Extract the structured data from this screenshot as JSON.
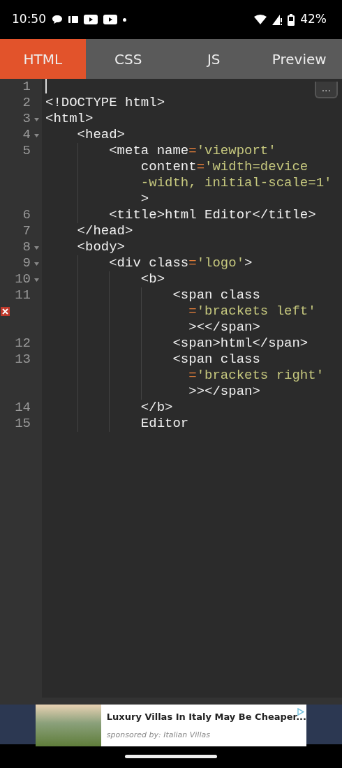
{
  "status_bar": {
    "time": "10:50",
    "battery": "42%"
  },
  "tabs": [
    {
      "label": "HTML",
      "selected": true
    },
    {
      "label": "CSS",
      "selected": false
    },
    {
      "label": "JS",
      "selected": false
    },
    {
      "label": "Preview",
      "selected": false
    }
  ],
  "editor": {
    "menu_button": "...",
    "rows": [
      {
        "number": "1",
        "fold": false,
        "error": false,
        "cursor": true,
        "tokens": []
      },
      {
        "number": "2",
        "fold": false,
        "error": false,
        "cursor": false,
        "tokens": [
          {
            "kind": "tag",
            "text": "<!DOCTYPE html>"
          }
        ]
      },
      {
        "number": "3",
        "fold": true,
        "error": false,
        "cursor": false,
        "tokens": [
          {
            "kind": "tag",
            "text": "<html>"
          }
        ]
      },
      {
        "number": "4",
        "fold": true,
        "error": false,
        "cursor": false,
        "tokens": [
          {
            "kind": "tag",
            "text": "    <head>"
          }
        ]
      },
      {
        "number": "5",
        "fold": false,
        "error": false,
        "cursor": false,
        "tokens": [
          {
            "kind": "tag",
            "text": "        <meta name"
          },
          {
            "kind": "eq",
            "text": "="
          },
          {
            "kind": "str",
            "text": "'viewport'"
          }
        ]
      },
      {
        "fold": false,
        "error": false,
        "cursor": false,
        "tokens": [
          {
            "kind": "tag",
            "text": "            content"
          },
          {
            "kind": "eq",
            "text": "="
          },
          {
            "kind": "str",
            "text": "'width=device"
          }
        ]
      },
      {
        "fold": false,
        "error": false,
        "cursor": false,
        "tokens": [
          {
            "kind": "str",
            "text": "            -width, initial-scale=1'"
          }
        ]
      },
      {
        "fold": false,
        "error": false,
        "cursor": false,
        "tokens": [
          {
            "kind": "tag",
            "text": "            >"
          }
        ]
      },
      {
        "number": "6",
        "fold": false,
        "error": false,
        "cursor": false,
        "tokens": [
          {
            "kind": "tag",
            "text": "        <title>html Editor</title>"
          }
        ]
      },
      {
        "number": "7",
        "fold": false,
        "error": false,
        "cursor": false,
        "tokens": [
          {
            "kind": "tag",
            "text": "    </head>"
          }
        ]
      },
      {
        "number": "8",
        "fold": true,
        "error": false,
        "cursor": false,
        "tokens": [
          {
            "kind": "tag",
            "text": "    <body>"
          }
        ]
      },
      {
        "number": "9",
        "fold": true,
        "error": false,
        "cursor": false,
        "tokens": [
          {
            "kind": "tag",
            "text": "        <div class"
          },
          {
            "kind": "eq",
            "text": "="
          },
          {
            "kind": "str",
            "text": "'logo'"
          },
          {
            "kind": "tag",
            "text": ">"
          }
        ]
      },
      {
        "number": "10",
        "fold": true,
        "error": false,
        "cursor": false,
        "tokens": [
          {
            "kind": "tag",
            "text": "            <b>"
          }
        ]
      },
      {
        "number": "11",
        "fold": false,
        "error": false,
        "cursor": false,
        "tokens": [
          {
            "kind": "tag",
            "text": "                <span class"
          }
        ]
      },
      {
        "fold": false,
        "error": true,
        "cursor": false,
        "tokens": [
          {
            "kind": "eq",
            "text": "                  ="
          },
          {
            "kind": "str",
            "text": "'brackets left'"
          }
        ]
      },
      {
        "fold": false,
        "error": false,
        "cursor": false,
        "tokens": [
          {
            "kind": "tag",
            "text": "                  ><</span>"
          }
        ]
      },
      {
        "number": "12",
        "fold": false,
        "error": false,
        "cursor": false,
        "tokens": [
          {
            "kind": "tag",
            "text": "                <span>html</span>"
          }
        ]
      },
      {
        "number": "13",
        "fold": false,
        "error": false,
        "cursor": false,
        "tokens": [
          {
            "kind": "tag",
            "text": "                <span class"
          }
        ]
      },
      {
        "fold": false,
        "error": false,
        "cursor": false,
        "tokens": [
          {
            "kind": "eq",
            "text": "                  ="
          },
          {
            "kind": "str",
            "text": "'brackets right'"
          }
        ]
      },
      {
        "fold": false,
        "error": false,
        "cursor": false,
        "tokens": [
          {
            "kind": "tag",
            "text": "                  >></span>"
          }
        ]
      },
      {
        "number": "14",
        "fold": false,
        "error": false,
        "cursor": false,
        "tokens": [
          {
            "kind": "tag",
            "text": "            </b>"
          }
        ]
      },
      {
        "number": "15",
        "fold": false,
        "error": false,
        "cursor": false,
        "tokens": [
          {
            "kind": "tag",
            "text": "            Editor"
          }
        ]
      }
    ]
  },
  "ad": {
    "title": "Luxury Villas In Italy May Be Cheaper...",
    "sponsor": "sponsored by: Italian Villas"
  }
}
